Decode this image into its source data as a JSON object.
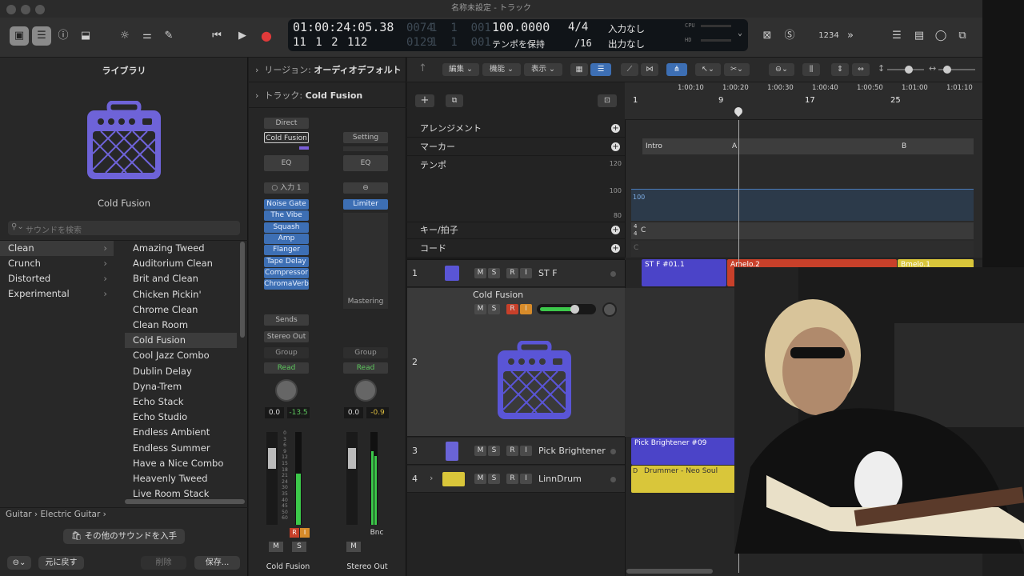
{
  "window": {
    "title": "名称未設定 - トラック"
  },
  "lcd": {
    "position": "01:00:24:05.38",
    "bars_dim": "0074",
    "bars_sub": "1  1  001",
    "bars": "11 1 2 112",
    "bars2_dim": "0129",
    "bars2_sub": "1  1  001",
    "tempo": "100.0000",
    "tempo_label": "テンポを保持",
    "signature": "4/4",
    "division": "/16",
    "input": "入力なし",
    "output": "出力なし",
    "cpu": "CPU",
    "hd": "HD"
  },
  "toolbar": {
    "count_in": "1234"
  },
  "library": {
    "title": "ライブラリ",
    "patch_name": "Cold Fusion",
    "search_placeholder": "サウンドを検索",
    "categories": [
      "Clean",
      "Crunch",
      "Distorted",
      "Experimental"
    ],
    "presets": [
      "Amazing Tweed",
      "Auditorium Clean",
      "Brit and Clean",
      "Chicken Pickin'",
      "Chrome Clean",
      "Clean Room",
      "Cold Fusion",
      "Cool Jazz Combo",
      "Dublin Delay",
      "Dyna-Trem",
      "Echo Stack",
      "Echo Studio",
      "Endless Ambient",
      "Endless Summer",
      "Have a Nice Combo",
      "Heavenly Tweed",
      "Live Room Stack"
    ],
    "breadcrumb": "Guitar › Electric Guitar ›",
    "get_more": "その他のサウンドを入手",
    "revert": "元に戻す",
    "delete": "削除",
    "save": "保存..."
  },
  "inspector": {
    "region_label": "リージョン:",
    "region_value": "オーディオデフォルト",
    "track_label": "トラック:",
    "track_value": "Cold Fusion"
  },
  "mixer": {
    "strip1": {
      "direct": "Direct",
      "setting": "Cold Fusion",
      "eq": "EQ",
      "input": "入力 1",
      "plugins": [
        "Noise Gate",
        "The Vibe",
        "Squash",
        "Amp",
        "Flanger",
        "Tape Delay",
        "Compressor",
        "ChromaVerb"
      ],
      "sends": "Sends",
      "output": "Stereo Out",
      "group": "Group",
      "automation": "Read",
      "pan": "0.0",
      "level": "-13.5",
      "name": "Cold Fusion",
      "m": "M",
      "s": "S",
      "r": "R",
      "i": "I"
    },
    "strip2": {
      "setting": "Setting",
      "eq": "EQ",
      "plugins": [
        "Limiter"
      ],
      "mastering": "Mastering",
      "group": "Group",
      "automation": "Read",
      "pan": "0.0",
      "level": "-0.9",
      "bnc": "Bnc",
      "name": "Stereo Out",
      "m": "M"
    },
    "fader_scale": [
      "0",
      "3",
      "6",
      "9",
      "12",
      "15",
      "18",
      "21",
      "24",
      "30",
      "35",
      "40",
      "45",
      "50",
      "60"
    ]
  },
  "tracks_toolbar": {
    "edit": "編集",
    "functions": "機能",
    "view": "表示"
  },
  "ruler": {
    "times": [
      "1:00:10",
      "1:00:20",
      "1:00:30",
      "1:00:40",
      "1:00:50",
      "1:01:00",
      "1:01:10"
    ],
    "bars": [
      "1",
      "9",
      "17",
      "25"
    ]
  },
  "global_tracks": {
    "arrangement": "アレンジメント",
    "marker": "マーカー",
    "tempo": "テンポ",
    "tempo_max": "120",
    "tempo_mid": "100",
    "tempo_min": "80",
    "key": "キー/拍子",
    "chord": "コード",
    "markers": [
      "Intro",
      "A",
      "B"
    ],
    "tempo_value": "100",
    "signature_top": "4",
    "signature_bottom": "4",
    "key_value": "C",
    "chord_value": "C"
  },
  "track_list": [
    {
      "num": "1",
      "name": "ST F"
    },
    {
      "num": "2",
      "name": "Cold Fusion"
    },
    {
      "num": "3",
      "name": "Pick Brightener"
    },
    {
      "num": "4",
      "name": "LinnDrum"
    }
  ],
  "buttons": {
    "m": "M",
    "s": "S",
    "r": "R",
    "i": "I"
  },
  "regions": {
    "r1": "ST F #01.1",
    "r2": "Amelo.2",
    "r3": "Bmelo.1",
    "r4": "Pick Brightener #09",
    "r5": "Drummer - Neo Soul",
    "r5_tag": "D"
  },
  "colors": {
    "accent": "#5a55d6",
    "amp": "#6e63d8",
    "red": "#c8402a",
    "yellow": "#d9c63a",
    "plugin": "#3d6fb4"
  }
}
